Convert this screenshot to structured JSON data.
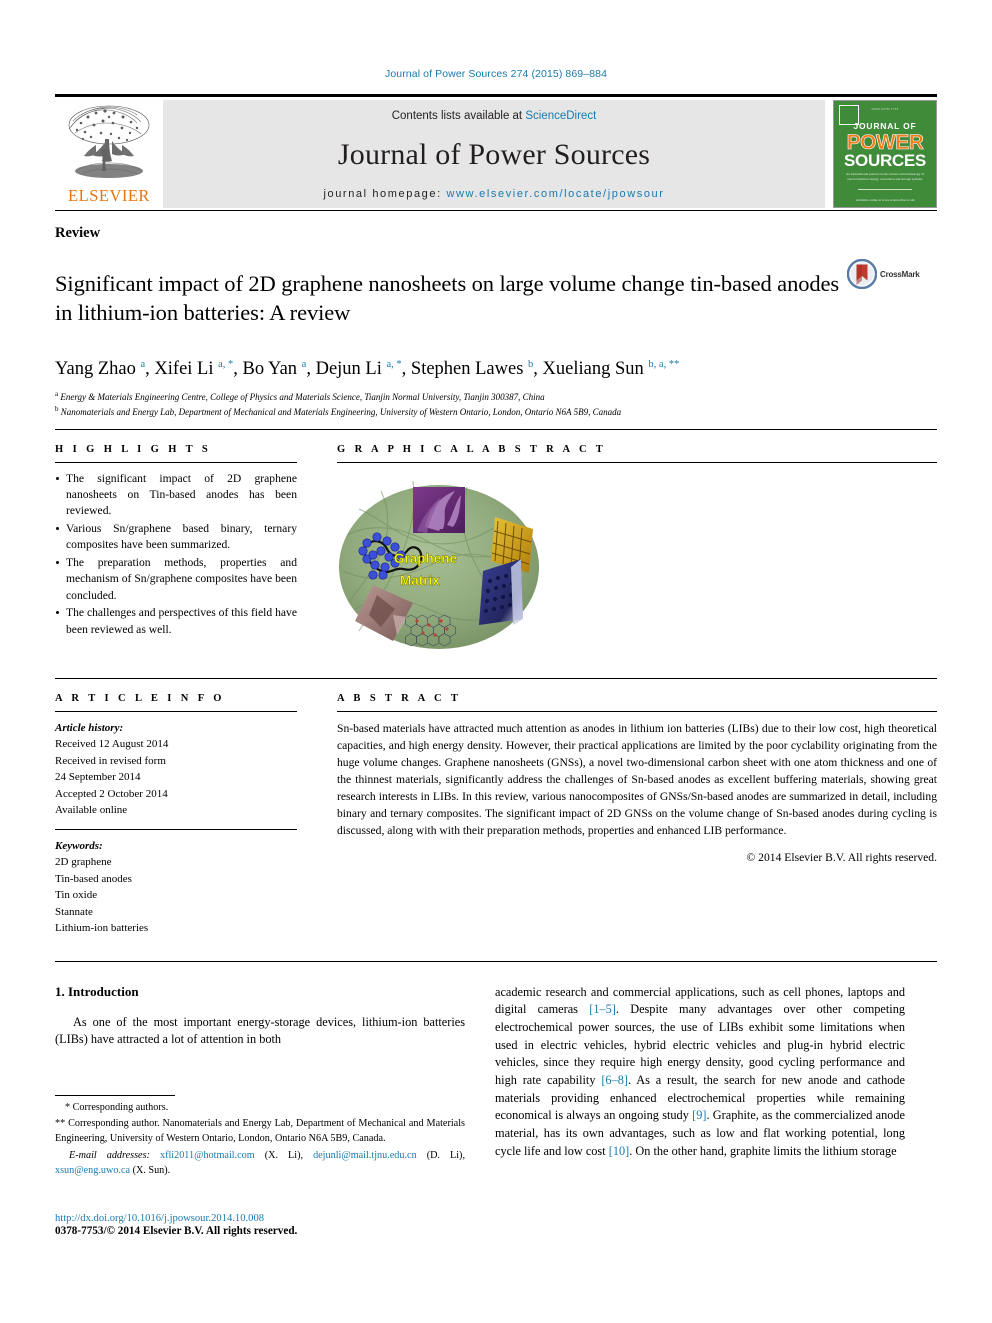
{
  "running_head": "Journal of Power Sources 274 (2015) 869–884",
  "masthead": {
    "contents_prefix": "Contents lists available at ",
    "contents_link": "ScienceDirect",
    "journal_name": "Journal of Power Sources",
    "homepage_prefix": "journal homepage: ",
    "homepage_url": "www.elsevier.com/locate/jpowsour",
    "publisher_wordmark": "ELSEVIER",
    "cover": {
      "tiny_top": "ISSN 0378-7753",
      "line1": "JOURNAL OF",
      "line2": "POWER",
      "line3": "SOURCES",
      "blurb": "An international journal on the science and technology of electrochemical energy conversion and storage systems",
      "footer": "Available online at www.sciencedirect.com"
    }
  },
  "article": {
    "kind": "Review",
    "title": "Significant impact of 2D graphene nanosheets on large volume change tin-based anodes in lithium-ion batteries: A review",
    "crossmark_label": "CrossMark",
    "authors_html": "Yang Zhao <sup>a</sup>, Xifei Li <sup>a, *</sup>, Bo Yan <sup>a</sup>, Dejun Li <sup>a, *</sup>, Stephen Lawes <sup>b</sup>, Xueliang Sun <sup>b, a, **</sup>",
    "affiliations": [
      {
        "mark": "a",
        "text": "Energy & Materials Engineering Centre, College of Physics and Materials Science, Tianjin Normal University, Tianjin 300387, China"
      },
      {
        "mark": "b",
        "text": "Nanomaterials and Energy Lab, Department of Mechanical and Materials Engineering, University of Western Ontario, London, Ontario N6A 5B9, Canada"
      }
    ]
  },
  "highlights": {
    "heading": "H I G H L I G H T S",
    "items": [
      "The significant impact of 2D graphene nanosheets on Tin-based anodes has been reviewed.",
      "Various Sn/graphene based binary, ternary composites have been summarized.",
      "The preparation methods, properties and mechanism of Sn/graphene composites have been concluded.",
      "The challenges and perspectives of this field have been reviewed as well."
    ]
  },
  "graphical_abstract": {
    "heading": "G R A P H I C A L   A B S T R A C T",
    "caption_line1": "Graphene",
    "caption_line2": "Matrix",
    "colors": {
      "matrix_green": "#8aa87a",
      "caption_yellow": "#ffff00",
      "purple_sem": "#6b2d7a",
      "gold_lattice": "#d6a400",
      "blue_particles": "#3b4fd8",
      "pink_flake": "#a9817d",
      "navy_sheet": "#2b2f7a"
    }
  },
  "article_info": {
    "heading": "A R T I C L E   I N F O",
    "history_label": "Article history:",
    "history": [
      "Received 12 August 2014",
      "Received in revised form",
      "24 September 2014",
      "Accepted 2 October 2014",
      "Available online"
    ],
    "keywords_label": "Keywords:",
    "keywords": [
      "2D graphene",
      "Tin-based anodes",
      "Tin oxide",
      "Stannate",
      "Lithium-ion batteries"
    ]
  },
  "abstract": {
    "heading": "A B S T R A C T",
    "text": "Sn-based materials have attracted much attention as anodes in lithium ion batteries (LIBs) due to their low cost, high theoretical capacities, and high energy density. However, their practical applications are limited by the poor cyclability originating from the huge volume changes. Graphene nanosheets (GNSs), a novel two-dimensional carbon sheet with one atom thickness and one of the thinnest materials, significantly address the challenges of Sn-based anodes as excellent buffering materials, showing great research interests in LIBs. In this review, various nanocomposites of GNSs/Sn-based anodes are summarized in detail, including binary and ternary composites. The significant impact of 2D GNSs on the volume change of Sn-based anodes during cycling is discussed, along with with their preparation methods, properties and enhanced LIB performance.",
    "copyright": "© 2014 Elsevier B.V. All rights reserved."
  },
  "body": {
    "section_number_title": "1. Introduction",
    "left_paragraph": "As one of the most important energy-storage devices, lithium-ion batteries (LIBs) have attracted a lot of attention in both",
    "right_paragraph_html": "academic research and commercial applications, such as cell phones, laptops and digital cameras <span class=\"ref\">[1&#8211;5]</span>. Despite many advantages over other competing electrochemical power sources, the use of LIBs exhibit some limitations when used in electric vehicles, hybrid electric vehicles and plug-in hybrid electric vehicles, since they require high energy density, good cycling performance and high rate capability <span class=\"ref\">[6&#8211;8]</span>. As a result, the search for new anode and cathode materials providing enhanced electrochemical properties while remaining economical is always an ongoing study <span class=\"ref\">[9]</span>. Graphite, as the commercialized anode material, has its own advantages, such as low and flat working potential, long cycle life and low cost <span class=\"ref\">[10]</span>. On the other hand, graphite limits the lithium storage"
  },
  "footnotes": {
    "line1": "* Corresponding authors.",
    "line2": "** Corresponding author. Nanomaterials and Energy Lab, Department of Mechanical and Materials Engineering, University of Western Ontario, London, Ontario N6A 5B9, Canada.",
    "email_label": "E-mail addresses:",
    "emails": [
      {
        "address": "xfli2011@hotmail.com",
        "person": "(X. Li)"
      },
      {
        "address": "dejunli@mail.tjnu.edu.cn",
        "person": "(D. Li)"
      },
      {
        "address": "xsun@eng.uwo.ca",
        "person": "(X. Sun)"
      }
    ]
  },
  "footer": {
    "doi": "http://dx.doi.org/10.1016/j.jpowsour.2014.10.008",
    "issn_line": "0378-7753/© 2014 Elsevier B.V. All rights reserved."
  },
  "colors": {
    "link_blue": "#1a7aad",
    "elsevier_orange": "#e87511",
    "masthead_gray": "#e6e6e6",
    "cover_green": "#3f8b3a"
  }
}
